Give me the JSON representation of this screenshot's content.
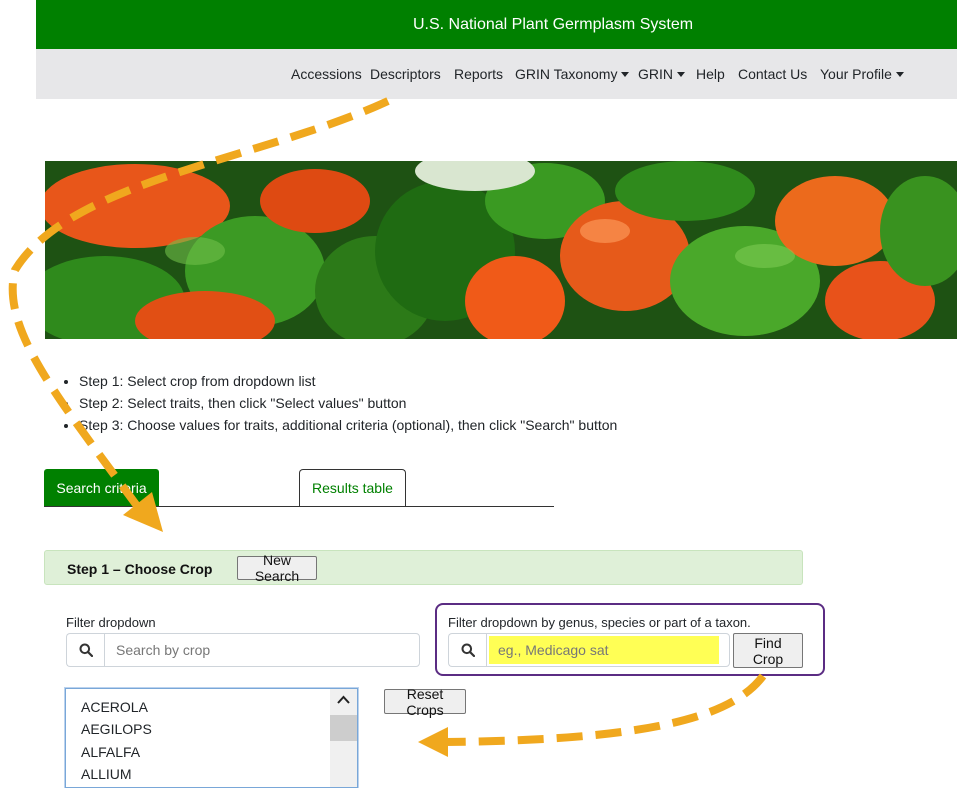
{
  "site": {
    "title": "U.S. National Plant Germplasm System"
  },
  "nav": {
    "items": [
      {
        "label": "Accessions",
        "dropdown": false
      },
      {
        "label": "Descriptors",
        "dropdown": false
      },
      {
        "label": "Reports",
        "dropdown": false
      },
      {
        "label": "GRIN Taxonomy",
        "dropdown": true
      },
      {
        "label": "GRIN",
        "dropdown": true
      },
      {
        "label": "Help",
        "dropdown": false
      },
      {
        "label": "Contact Us",
        "dropdown": false
      },
      {
        "label": "Your Profile",
        "dropdown": true
      }
    ]
  },
  "instructions": [
    "Step 1: Select crop from dropdown list",
    "Step 2: Select traits, then click \"Select values\" button",
    "Step 3: Choose values for traits, additional criteria (optional), then click \"Search\" button"
  ],
  "tabs": {
    "active": "Search criteria",
    "inactive": "Results table"
  },
  "step1": {
    "title": "Step 1 – Choose Crop",
    "new_search": "New Search",
    "filter_label": "Filter dropdown",
    "filter_placeholder": "Search by crop",
    "taxon_label": "Filter dropdown by genus, species or part of a taxon.",
    "taxon_placeholder": "eg., Medicago sat",
    "find_crop": "Find Crop",
    "reset_crops": "Reset Crops",
    "crops": [
      "ACEROLA",
      "AEGILOPS",
      "ALFALFA",
      "ALLIUM"
    ]
  },
  "colors": {
    "brand_green": "#008000",
    "navbar_gray": "#e7e7e9",
    "step_header": "#dff0d8",
    "highlight_yellow": "#ffff55",
    "annotation_orange": "#f0a81e",
    "annotation_purple": "#5b2c83"
  }
}
